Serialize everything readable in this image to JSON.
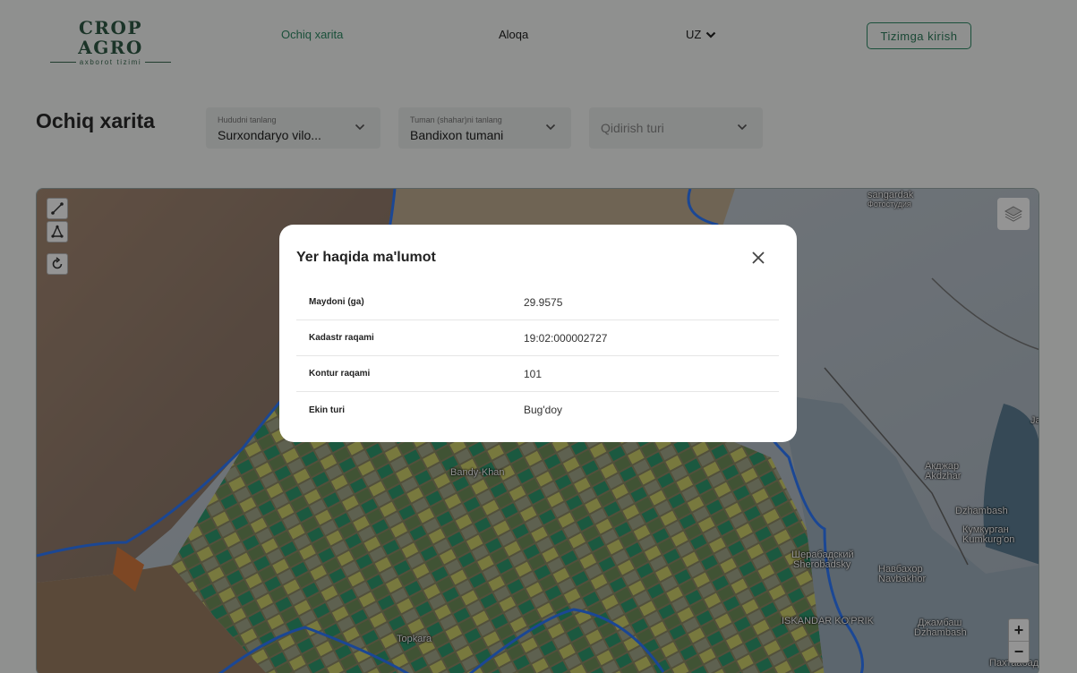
{
  "header": {
    "logo_title": "CROP AGRO",
    "logo_subtitle": "axborot tizimi",
    "nav": [
      {
        "label": "Ochiq xarita"
      },
      {
        "label": "Aloqa"
      }
    ],
    "language": "UZ",
    "login_label": "Tizimga kirish"
  },
  "page": {
    "title": "Ochiq xarita",
    "filters": {
      "region": {
        "label": "Hududni tanlang",
        "value": "Surxondaryo vilo..."
      },
      "district": {
        "label": "Tuman (shahar)ni tanlang",
        "value": "Bandixon tumani"
      },
      "search_type": {
        "placeholder": "Qidirish turi"
      }
    }
  },
  "map": {
    "labels": [
      {
        "text": "sangardak"
      },
      {
        "text": "Фотостудия"
      },
      {
        "text": "Bandy-Khan"
      },
      {
        "text": "Topkara"
      },
      {
        "text": "Акджар"
      },
      {
        "text": "Akdzhar"
      },
      {
        "text": "Dzhambash"
      },
      {
        "text": "Кумкурган"
      },
      {
        "text": "Kumkurg'on"
      },
      {
        "text": "Шерабадский"
      },
      {
        "text": "Sherobadsky"
      },
      {
        "text": "Навбахор"
      },
      {
        "text": "Navbakhor"
      },
      {
        "text": "ISKANDAR KO'PRIK"
      },
      {
        "text": "Джамбаш"
      },
      {
        "text": "Dzhambash"
      },
      {
        "text": "Пахтаабад"
      },
      {
        "text": "Ja"
      }
    ],
    "zoom_in": "+",
    "zoom_out": "−"
  },
  "modal": {
    "title": "Yer haqida ma'lumot",
    "rows": [
      {
        "key": "Maydoni (ga)",
        "value": "29.9575"
      },
      {
        "key": "Kadastr raqami",
        "value": "19:02:000002727"
      },
      {
        "key": "Kontur raqami",
        "value": "101"
      },
      {
        "key": "Ekin turi",
        "value": "Bug'doy"
      }
    ]
  },
  "colors": {
    "brand": "#2f5a45",
    "accent": "#2e8a64",
    "boundary": "#3a7bff"
  },
  "icons": [
    "line-draw-icon",
    "polygon-draw-icon",
    "reset-icon",
    "layers-icon",
    "chevron-down-icon",
    "close-icon"
  ]
}
